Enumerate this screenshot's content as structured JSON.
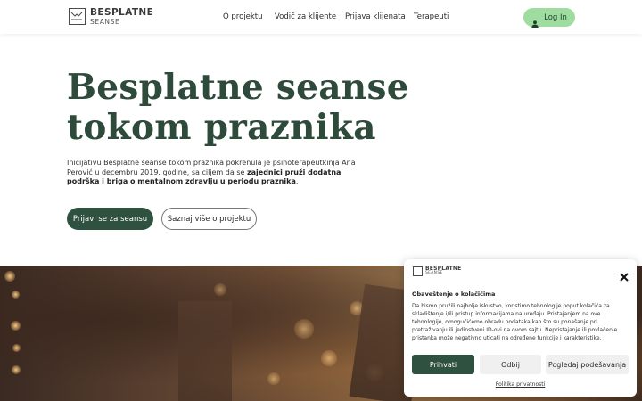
{
  "header": {
    "logo": {
      "name": "BESPLATNE",
      "sub": "SEANSE"
    },
    "nav": [
      {
        "label": "O projektu"
      },
      {
        "label": "Vodič za klijente"
      },
      {
        "label": "Prijava klijenata"
      },
      {
        "label": "Terapeuti"
      }
    ],
    "login": {
      "label": "Log In",
      "icon": "user-icon"
    }
  },
  "hero": {
    "title_line1": "Besplatne seanse",
    "title_line2": "tokom praznika",
    "intro_plain": "Inicijativu Besplatne seanse tokom praznika pokrenula je psihoterapeutkinja Ana Perović u decembru 2019. godine, sa ciljem da se ",
    "intro_bold": "zajednici pruži dodatna podrška i briga o mentalnom zdravlju u periodu praznika",
    "intro_end": ".",
    "primary_button": "Prijavi se za seansu",
    "secondary_button": "Saznaj više o projektu"
  },
  "cookie": {
    "logo": {
      "name": "BESPLATNE",
      "sub": "SEANSE"
    },
    "title": "Obaveštenje o kolačićima",
    "text": "Da bismo pružili najbolje iskustvo, koristimo tehnologije poput kolačića za skladištenje i/ili pristup informacijama na uređaju. Pristajanjem na ove tehnologije, omogućićemo obradu podataka kao što su ponašanje pri pretraživanju ili jedinstveni ID-ovi na ovom sajtu. Nepristajanje ili povlačenje pristanka može negativno uticati na određene funkcije i karakteristike.",
    "accept": "Prihvati",
    "deny": "Odbij",
    "preferences": "Pogledaj podešavanja",
    "privacy_link": "Politika privatnosti",
    "close_icon": "close-icon"
  },
  "colors": {
    "brand_green": "#2f5240",
    "login_green": "#9fdc9f",
    "title_green": "#2d4a3a"
  }
}
